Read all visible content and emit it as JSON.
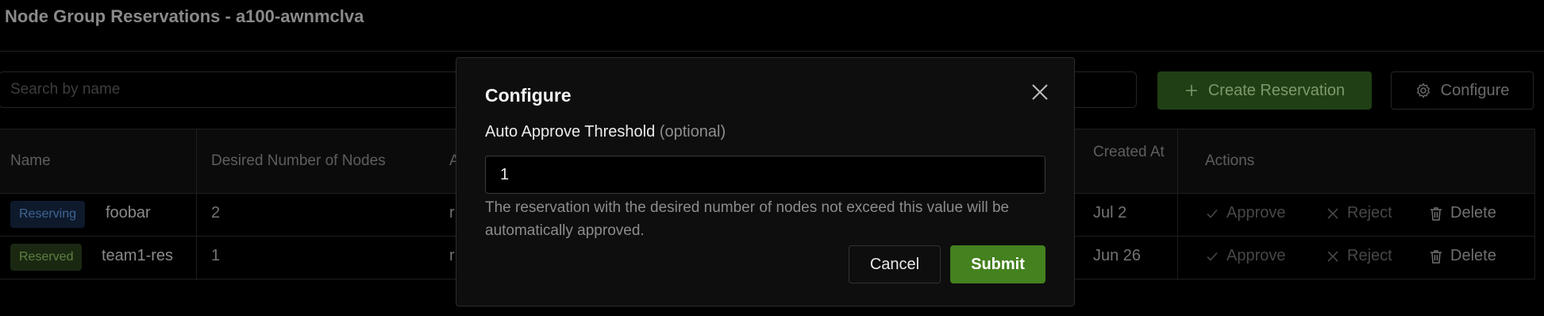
{
  "page": {
    "title": "Node Group Reservations - a100-awnmclva"
  },
  "toolbar": {
    "search_placeholder": "Search by name",
    "create_label": "Create Reservation",
    "configure_label": "Configure"
  },
  "table": {
    "columns": [
      "Name",
      "Desired Number of Nodes",
      "A",
      "Created At",
      "Actions"
    ],
    "rows": [
      {
        "status": "Reserving",
        "name": "foobar",
        "desired_nodes": "2",
        "col3_partial": "r",
        "created_at": "Jul 2"
      },
      {
        "status": "Reserved",
        "name": "team1-res",
        "desired_nodes": "1",
        "col3_partial": "r",
        "created_at": "Jun 26"
      }
    ],
    "actions": {
      "approve": "Approve",
      "reject": "Reject",
      "delete": "Delete"
    }
  },
  "modal": {
    "title": "Configure",
    "field_label": "Auto Approve Threshold",
    "field_optional": "(optional)",
    "field_value": "1",
    "help_text": "The reservation with the desired number of nodes not exceed this value will be automatically approved.",
    "cancel_label": "Cancel",
    "submit_label": "Submit"
  },
  "colors": {
    "background": "#000000",
    "primary_green": "#44811f",
    "create_button_bg": "#213f14",
    "badge_reserving": "#3e6494",
    "badge_reserved": "#5c8040"
  },
  "icons": [
    "plus-icon",
    "gear-icon",
    "close-icon",
    "check-icon",
    "x-icon",
    "trash-icon"
  ]
}
